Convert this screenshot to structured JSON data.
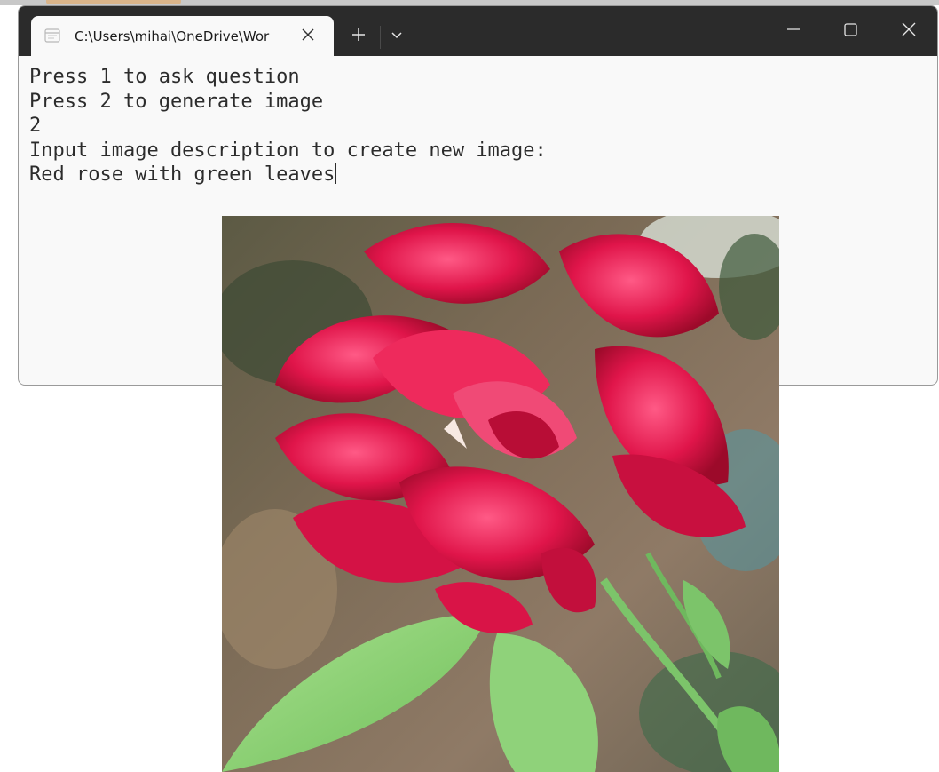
{
  "tab": {
    "title": "C:\\Users\\mihai\\OneDrive\\Wor",
    "icon": "terminal-icon"
  },
  "titlebar_buttons": {
    "new_tab_icon": "plus-icon",
    "dropdown_icon": "chevron-down-icon",
    "minimize_icon": "minimize-icon",
    "maximize_icon": "maximize-icon",
    "close_icon": "close-icon"
  },
  "console": {
    "lines": [
      "Press 1 to ask question",
      "Press 2 to generate image",
      "2",
      "Input image description to create new image:",
      "Red rose with green leaves"
    ]
  },
  "colors": {
    "titlebar": "#2b2b2b",
    "terminal_background": "#f9f9f9",
    "terminal_text": "#2c2c2c",
    "rose": "#e0154a"
  }
}
